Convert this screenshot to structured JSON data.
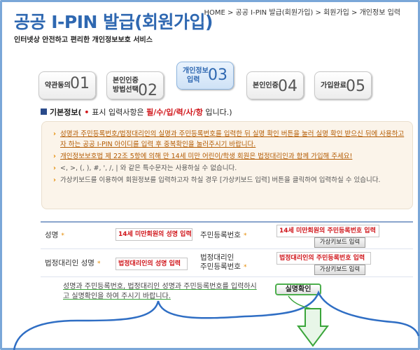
{
  "header": {
    "title": "공공 I-PIN 발급(회원가입)",
    "subtitle": "인터넷상 안전하고 편리한 개인정보보호 서비스",
    "breadcrumb": "HOME > 공공 I-PIN 발급(회원가입) > 회원가입 > 개인정보 입력"
  },
  "steps": [
    {
      "label_line1": "약관동의",
      "label_line2": "",
      "number": "01",
      "active": false
    },
    {
      "label_line1": "본인인증",
      "label_line2": "방법선택",
      "number": "02",
      "active": false
    },
    {
      "label_line1": "개인정보",
      "label_line2": "입력",
      "number": "03",
      "active": true
    },
    {
      "label_line1": "본인인증",
      "label_line2": "",
      "number": "04",
      "active": false
    },
    {
      "label_line1": "가입완료",
      "label_line2": "",
      "number": "05",
      "active": false
    }
  ],
  "section": {
    "title": "기본정보(",
    "dot": "•",
    "text_before": "표시 입력사항은 ",
    "required": "필/수/입/력/사/항",
    "text_after": " 입니다.)"
  },
  "info_items": [
    "성명과 주민등록번호/법정대리인의 실명과 주민등록번호를 입력한 뒤 실명 확인 버튼을 눌러 실명 확인 받으신 뒤에 사용하고자 하는 공공 I-PIN 아이디를 입력 후 중복확인을 눌러주시기 바랍니다.",
    "개인정보보호법 제 22조 5항에 의해 만 14세 미만 어린이/학생 회원은 법정대리인과 함께 가입해 주세요!",
    "<, >, (, ), #, ', /, | 와 같은 특수문자는 사용하실 수 없습니다.",
    "가상키보드를 이용하여 회원정보를 입력하고자 하실 경우 [가상키보드 입력] 버튼을 클릭하여 입력하실 수 있습니다."
  ],
  "form": {
    "star": "*",
    "name_label": "성명",
    "name_value": "14세 미만회원의 성명 입력",
    "rrn_label": "주민등록번호",
    "rrn_value": "14세 미만회원의 주민등록번호 입력",
    "vk_label": "가상키보드 입력",
    "guardian_name_label": "법정대리인 성명",
    "guardian_name_value": "법정대리인의 성명 입력",
    "guardian_rrn_label_line1": "법정대리인",
    "guardian_rrn_label_line2": "주민등록번호",
    "guardian_rrn_value": "법정대리인의 주민등록번호 입력"
  },
  "confirm": {
    "text": "성명과 주민등록번호, 법정대리인 성명과 주민등록번호를 입력하시고 실명확인을 하여 주시기 바랍니다.",
    "button": "실명확인"
  },
  "colors": {
    "title": "#2f68b1",
    "required": "#d0151a",
    "annotation_green": "#3aa53a",
    "annotation_blue": "#2f6ec4"
  }
}
